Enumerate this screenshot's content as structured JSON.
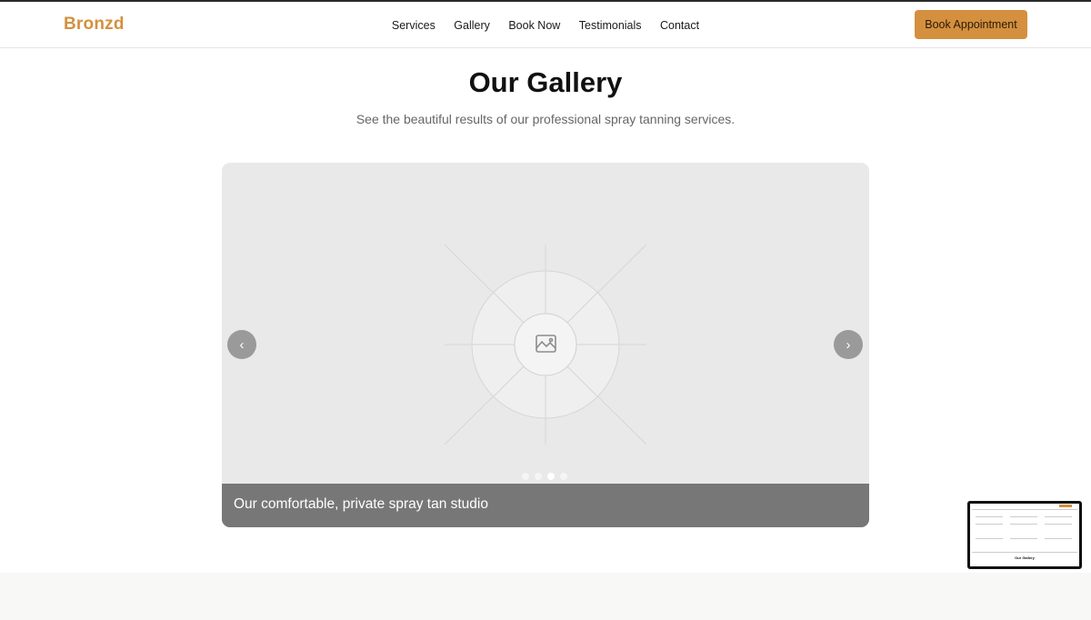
{
  "brand": {
    "name": "Bronzd",
    "color": "#d4903e"
  },
  "nav": {
    "items": [
      "Services",
      "Gallery",
      "Book Now",
      "Testimonials",
      "Contact"
    ],
    "cta_label": "Book Appointment"
  },
  "gallery": {
    "title": "Our Gallery",
    "subtitle": "See the beautiful results of our professional spray tanning services.",
    "slide_caption": "Our comfortable, private spray tan studio",
    "slide_count": 4,
    "active_slide_index": 2,
    "prev_icon": "chevron-left-icon",
    "next_icon": "chevron-right-icon",
    "placeholder_icon": "image-placeholder-icon"
  },
  "preview": {
    "title": "Our Gallery"
  }
}
